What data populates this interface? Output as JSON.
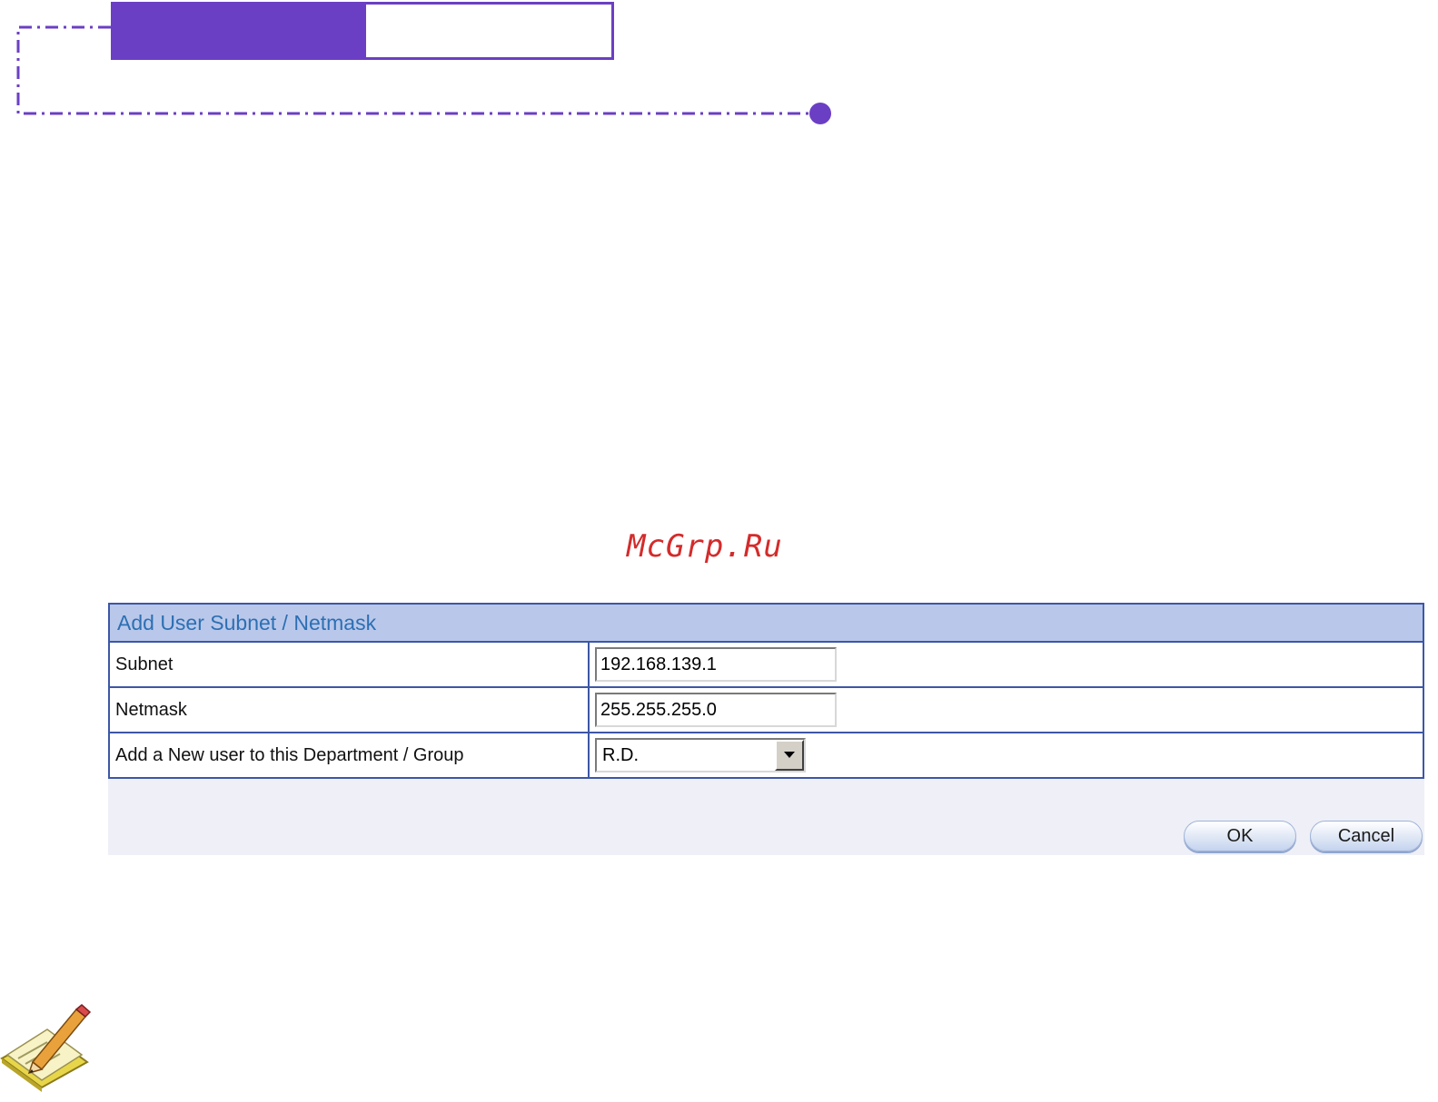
{
  "watermark": {
    "text": "McGrp.Ru"
  },
  "dialog": {
    "title": "Add User Subnet / Netmask",
    "fields": {
      "subnet": {
        "label": "Subnet",
        "value": "192.168.139.1"
      },
      "netmask": {
        "label": "Netmask",
        "value": "255.255.255.0"
      },
      "group": {
        "label": "Add a New user to this Department / Group",
        "selected": "R.D."
      }
    },
    "buttons": {
      "ok": "OK",
      "cancel": "Cancel"
    }
  },
  "colors": {
    "accent": "#6b3fc4",
    "panel_header": "#b9c8ea",
    "panel_border": "#3d57a6",
    "title_text": "#2d6fb3",
    "watermark": "#d42b2b"
  },
  "icons": {
    "note": "note-pencil-icon",
    "dropdown": "chevron-down-icon"
  }
}
